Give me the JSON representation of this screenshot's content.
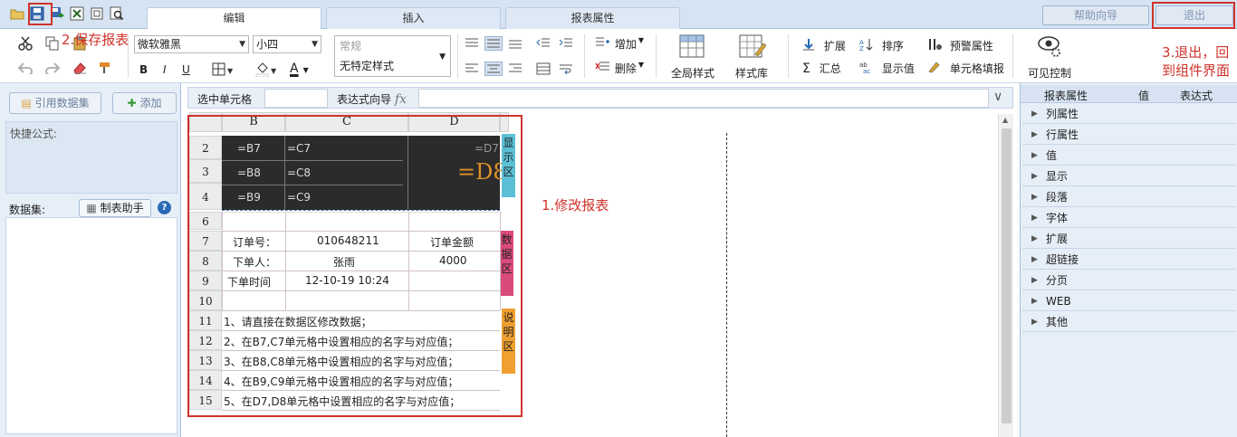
{
  "tabs": [
    {
      "label": "编辑",
      "active": true
    },
    {
      "label": "插入",
      "active": false
    },
    {
      "label": "报表属性",
      "active": false
    }
  ],
  "top_buttons": {
    "help": "帮助向导",
    "exit": "退出"
  },
  "annotations": {
    "save": "2.保存报表",
    "exit_line1": "3.退出，回",
    "exit_line2": "到组件界面",
    "modify": "1.修改报表"
  },
  "ribbon": {
    "font_name": "微软雅黑",
    "font_size": "小四",
    "style_placeholder": "常规",
    "style_value": "无特定样式",
    "bold": "B",
    "italic": "I",
    "underline": "U",
    "font_color": "A",
    "add": "增加",
    "delete": "删除",
    "global_style": "全局样式",
    "style_lib": "样式库",
    "expand": "扩展",
    "sort": "排序",
    "alert": "预警属性",
    "summary": "汇总",
    "show_value": "显示值",
    "cell_fill": "单元格填报",
    "visible_ctrl": "可见控制"
  },
  "left_panel": {
    "ref_dataset": "引用数据集",
    "add": "添加",
    "quick_formula": "快捷公式:",
    "dataset": "数据集:",
    "wizard": "制表助手"
  },
  "formula_bar": {
    "selected_cell": "选中单元格",
    "expr_wizard": "表达式向导",
    "fx": "fx"
  },
  "sheet": {
    "columns": [
      "B",
      "C",
      "D"
    ],
    "rows": [
      "2",
      "3",
      "4",
      "6",
      "7",
      "8",
      "9",
      "10",
      "11",
      "12",
      "13",
      "14",
      "15"
    ],
    "display_cells": {
      "b2": "=B7",
      "c2": "=C7",
      "d2": "=D7",
      "b3": "=B8",
      "c3": "=C8",
      "b4": "=B9",
      "c4": "=C9",
      "d8": "=D8"
    },
    "data_cells": {
      "b7": "订单号：",
      "c7": "010648211",
      "d7": "订单金额",
      "b8": "下单人：",
      "c8": "张雨",
      "d8": "4000",
      "b9": "下单时间",
      "c9": "12-10-19 10:24"
    },
    "notes": [
      "1、请直接在数据区修改数据；",
      "2、在B7,C7单元格中设置相应的名字与对应值；",
      "3、在B8,C8单元格中设置相应的名字与对应值；",
      "4、在B9,C9单元格中设置相应的名字与对应值；",
      "5、在D7,D8单元格中设置相应的名字与对应值；"
    ],
    "tag_display": [
      "显",
      "示",
      "区"
    ],
    "tag_data": [
      "数",
      "据",
      "区"
    ],
    "tag_desc": [
      "说",
      "明",
      "区"
    ],
    "tag_colors": {
      "display": "#5bc0d6",
      "data": "#d94a7d",
      "desc": "#f0a030"
    }
  },
  "right_panel": {
    "headers": [
      "报表属性",
      "值",
      "表达式"
    ],
    "items": [
      "列属性",
      "行属性",
      "值",
      "显示",
      "段落",
      "字体",
      "扩展",
      "超链接",
      "分页",
      "WEB",
      "其他"
    ]
  }
}
